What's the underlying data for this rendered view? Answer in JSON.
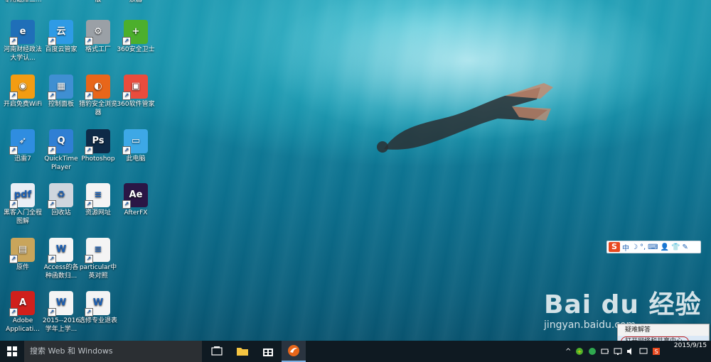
{
  "desktop": {
    "icons": [
      {
        "label": "专用题库二...",
        "color": "#1a5fb4",
        "glyph": ""
      },
      {
        "label": "版",
        "color": "#777",
        "glyph": ""
      },
      {
        "label": "放器",
        "color": "#777",
        "glyph": ""
      },
      {
        "label": "河南财经政法大学认...",
        "color": "#1f6fb8",
        "glyph": "e"
      },
      {
        "label": "百度云管家",
        "color": "#2e9be6",
        "glyph": "云"
      },
      {
        "label": "格式工厂",
        "color": "#9aa0a6",
        "glyph": "⚙"
      },
      {
        "label": "360安全卫士",
        "color": "#4caf2c",
        "glyph": "+"
      },
      {
        "label": "开启免费WiFi",
        "color": "#f39c12",
        "glyph": "◉"
      },
      {
        "label": "控制面板",
        "color": "#3f8fd2",
        "glyph": "▦"
      },
      {
        "label": "猎豹安全浏览器",
        "color": "#e8661a",
        "glyph": "◐"
      },
      {
        "label": "360软件管家",
        "color": "#e94c3d",
        "glyph": "▣"
      },
      {
        "label": "迅雷7",
        "color": "#2f8de0",
        "glyph": "➶"
      },
      {
        "label": "QuickTime Player",
        "color": "#2f7fd4",
        "glyph": "Q"
      },
      {
        "label": "Photoshop",
        "color": "#0e2a47",
        "glyph": "Ps"
      },
      {
        "label": "此电脑",
        "color": "#3da8e6",
        "glyph": "▭"
      },
      {
        "label": "黑客入门全程图解",
        "color": "#e9eef5",
        "glyph": "pdf"
      },
      {
        "label": "回收站",
        "color": "#cfd6de",
        "glyph": "♻"
      },
      {
        "label": "资源网址",
        "color": "#f4f4f4",
        "glyph": "≡"
      },
      {
        "label": "AfterFX",
        "color": "#2a1646",
        "glyph": "Ae"
      },
      {
        "label": "原件",
        "color": "#c9a55b",
        "glyph": "▤"
      },
      {
        "label": "Access的各种函数归...",
        "color": "#f4f4f4",
        "glyph": "W"
      },
      {
        "label": "particular中英对照",
        "color": "#f4f4f4",
        "glyph": "≡"
      },
      {
        "label": "Adobe Applicati...",
        "color": "#d0201c",
        "glyph": "A"
      },
      {
        "label": "2015--2016学年上学...",
        "color": "#f4f4f4",
        "glyph": "W"
      },
      {
        "label": "选修专业退表",
        "color": "#f4f4f4",
        "glyph": "W"
      }
    ]
  },
  "ime_toolbar": {
    "logo": "S",
    "mode": "中",
    "moon": "☽",
    "punct": "°,",
    "keyboard": "⌨",
    "user": "👤",
    "shirt": "👕",
    "tool": "✎"
  },
  "watermark": {
    "brand": "Bai du 经验",
    "url": "jingyan.baidu.com"
  },
  "context_menu": {
    "items": [
      "疑难解答",
      "打开网络和共享中心"
    ]
  },
  "taskbar": {
    "search_placeholder": "搜索 Web 和 Windows",
    "clock_time": "",
    "clock_date": "2015/9/15",
    "tray_chevron": "^"
  }
}
